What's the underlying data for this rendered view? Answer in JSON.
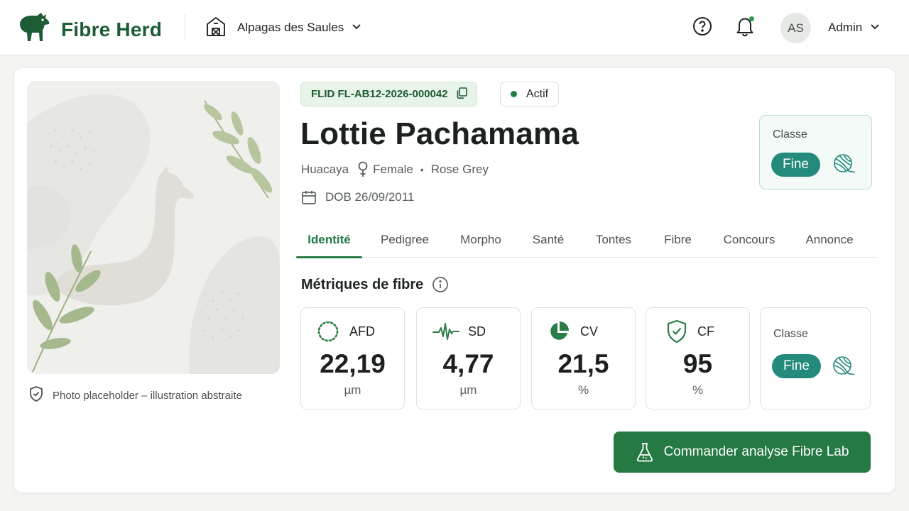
{
  "header": {
    "brand_name": "Fibre Herd",
    "brand_icon": "alpaca-logo-icon",
    "farm_selector": {
      "label": "Alpagas des Saules",
      "icon": "barn-icon"
    },
    "help_icon": "help-circle-icon",
    "notifications_icon": "bell-icon",
    "avatar_initials": "AS",
    "user_name": "Admin"
  },
  "photo": {
    "caption": "Photo placeholder – illustration abstraite"
  },
  "animal": {
    "flid": "FLID FL-AB12-2026-000042",
    "status": "Actif",
    "name": "Lottie Pachamama",
    "breed": "Huacaya",
    "sex": "Female",
    "color": "Rose Grey",
    "dob": "DOB 26/09/2011",
    "classe_label": "Classe",
    "classe_value": "Fine"
  },
  "tabs": [
    {
      "label": "Identité",
      "active": true
    },
    {
      "label": "Pedigree",
      "active": false
    },
    {
      "label": "Morpho",
      "active": false
    },
    {
      "label": "Santé",
      "active": false
    },
    {
      "label": "Tontes",
      "active": false
    },
    {
      "label": "Fibre",
      "active": false
    },
    {
      "label": "Concours",
      "active": false
    },
    {
      "label": "Annonce",
      "active": false
    }
  ],
  "fibre": {
    "title": "Métriques de fibre",
    "metrics": [
      {
        "label": "AFD",
        "value": "22,19",
        "unit": "µm",
        "icon": "dotted-circle-icon"
      },
      {
        "label": "SD",
        "value": "4,77",
        "unit": "µm",
        "icon": "pulse-wave-icon"
      },
      {
        "label": "CV",
        "value": "21,5",
        "unit": "%",
        "icon": "pie-chart-icon"
      },
      {
        "label": "CF",
        "value": "95",
        "unit": "%",
        "icon": "shield-check-icon"
      }
    ],
    "classe_label": "Classe",
    "classe_value": "Fine"
  },
  "cta": {
    "label": "Commander analyse Fibre Lab",
    "icon": "flask-icon"
  },
  "colors": {
    "brand": "#1d5c34",
    "accent": "#257a43",
    "teal": "#248a7c"
  }
}
